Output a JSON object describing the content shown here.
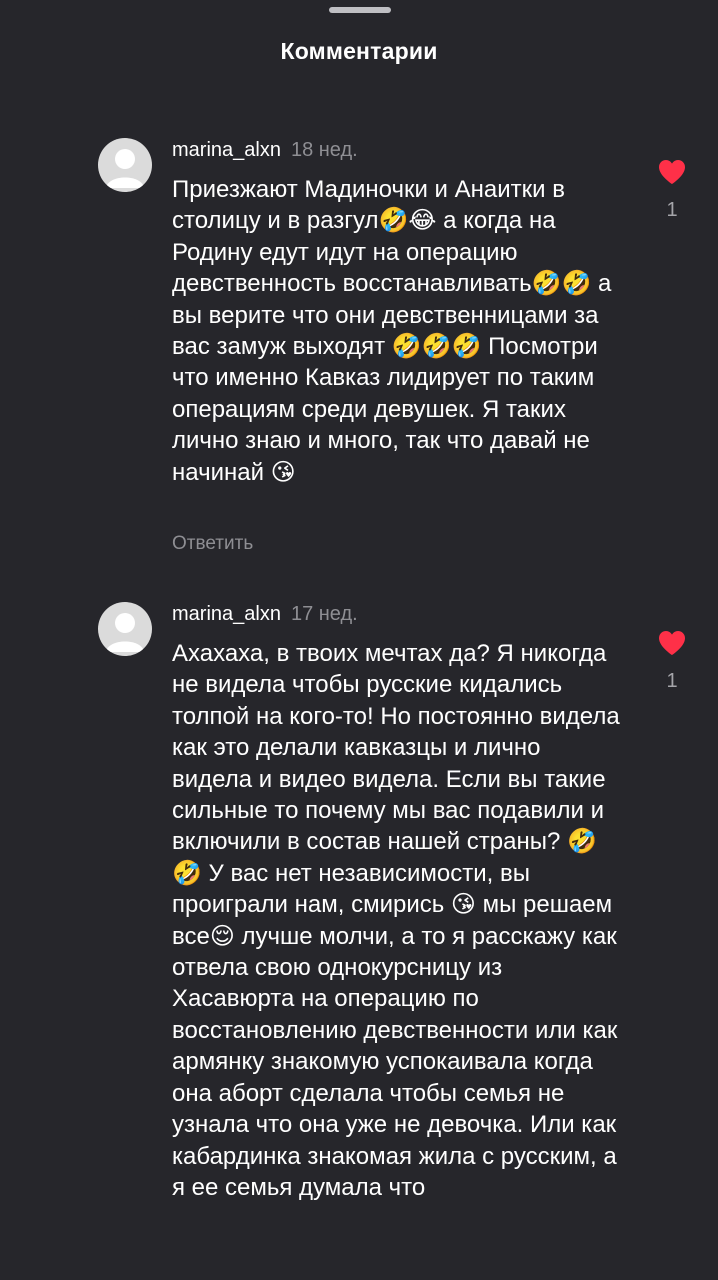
{
  "sheet": {
    "title": "Комментарии"
  },
  "comments": [
    {
      "username": "marina_alxn",
      "time": "18 нед.",
      "text": "Приезжают Мадиночки и Анаитки в столицу и в разгул🤣😂 а когда на Родину едут идут на операцию девственность восстанавливать🤣🤣 а вы верите что они девственницами за вас замуж выходят 🤣🤣🤣 Посмотри что именно Кавказ лидирует по таким операциям среди девушек. Я таких лично знаю и много, так что давай не начинай 😘",
      "reply_label": "Ответить",
      "likes": "1"
    },
    {
      "username": "marina_alxn",
      "time": "17 нед.",
      "text": "Ахахаха, в твоих мечтах да? Я никогда не видела чтобы русские кидались толпой на кого-то! Но постоянно видела как это делали кавказцы и лично видела и видео видела. Если вы такие сильные то почему мы вас подавили и включили в состав нашей страны? 🤣🤣 У вас нет независимости, вы проиграли нам, смирись 😘 мы решаем все😌 лучше молчи, а то я расскажу как отвела свою однокурсницу из Хасавюрта на операцию по восстановлению девственности или как армянку знакомую успокаивала когда она аборт сделала чтобы семья не узнала что она уже не девочка. Или как кабардинка знакомая жила с русским, а я ее семья думала что",
      "likes": "1"
    }
  ],
  "colors": {
    "background": "#26262b",
    "text": "#ffffff",
    "secondary": "#8e8e93",
    "like": "#ff3048"
  },
  "icons": {
    "avatar": "default-avatar-icon",
    "like": "heart-icon",
    "handle": "drag-handle"
  }
}
